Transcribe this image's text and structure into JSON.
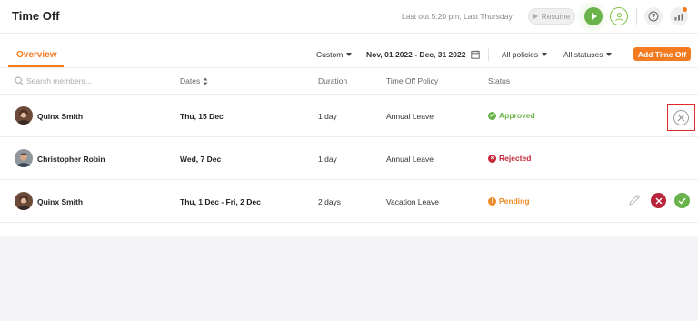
{
  "header": {
    "title": "Time Off",
    "last_out": "Last out 5:20 pm, Last Thursday",
    "resume_label": "Resume"
  },
  "tabs": {
    "overview": "Overview"
  },
  "filters": {
    "range_type": "Custom",
    "date_range": "Nov, 01 2022 - Dec, 31 2022",
    "policies": "All policies",
    "statuses": "All statuses",
    "add_button": "Add Time Off"
  },
  "table": {
    "search_placeholder": "Search members...",
    "columns": {
      "dates": "Dates",
      "duration": "Duration",
      "policy": "Time Off Policy",
      "status": "Status"
    },
    "rows": [
      {
        "member": "Quinx Smith",
        "dates": "Thu, 15 Dec",
        "duration": "1 day",
        "policy": "Annual Leave",
        "status": "Approved"
      },
      {
        "member": "Christopher Robin",
        "dates": "Wed, 7 Dec",
        "duration": "1 day",
        "policy": "Annual Leave",
        "status": "Rejected"
      },
      {
        "member": "Quinx Smith",
        "dates": "Thu, 1 Dec - Fri, 2 Dec",
        "duration": "2 days",
        "policy": "Vacation Leave",
        "status": "Pending"
      }
    ]
  },
  "colors": {
    "accent": "#f47b20",
    "approved": "#6ab24a",
    "rejected": "#c8283a",
    "pending": "#f08a24"
  }
}
